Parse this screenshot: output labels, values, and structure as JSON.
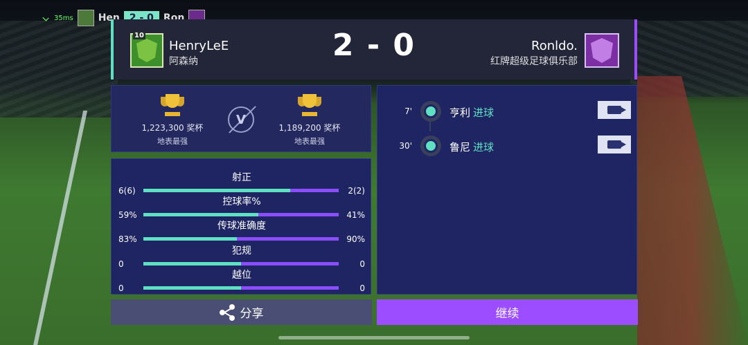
{
  "hud": {
    "ping": "35ms",
    "home_short": "Hen",
    "score_short": "2 - 0",
    "away_short": "Ron"
  },
  "header": {
    "home": {
      "name": "HenryLeE",
      "club": "阿森纳",
      "rating": "10",
      "badge_icon": "arsenal-crest-icon"
    },
    "score": "2 - 0",
    "away": {
      "name": "Ronldo.",
      "club": "红牌超级足球俱乐部",
      "badge_icon": "red-card-crest-icon"
    },
    "colors": {
      "home_accent": "#5fe0c3",
      "away_accent": "#9b4dff"
    }
  },
  "trophies": {
    "home": {
      "value": "1,223,300 奖杯",
      "rank": "地表最强"
    },
    "away": {
      "value": "1,189,200 奖杯",
      "rank": "地表最强"
    },
    "vs_label": "V"
  },
  "stats": [
    {
      "label": "射正",
      "home": "6(6)",
      "away": "2(2)",
      "home_share": 0.75
    },
    {
      "label": "控球率%",
      "home": "59%",
      "away": "41%",
      "home_share": 0.59
    },
    {
      "label": "传球准确度",
      "home": "83%",
      "away": "90%",
      "home_share": 0.48
    },
    {
      "label": "犯规",
      "home": "0",
      "away": "0",
      "home_share": 0.5
    },
    {
      "label": "越位",
      "home": "0",
      "away": "0",
      "home_share": 0.5
    }
  ],
  "events": [
    {
      "minute": "7'",
      "player": "亨利",
      "type": "进球"
    },
    {
      "minute": "30'",
      "player": "鲁尼",
      "type": "进球"
    }
  ],
  "buttons": {
    "share": "分享",
    "continue": "继续"
  }
}
